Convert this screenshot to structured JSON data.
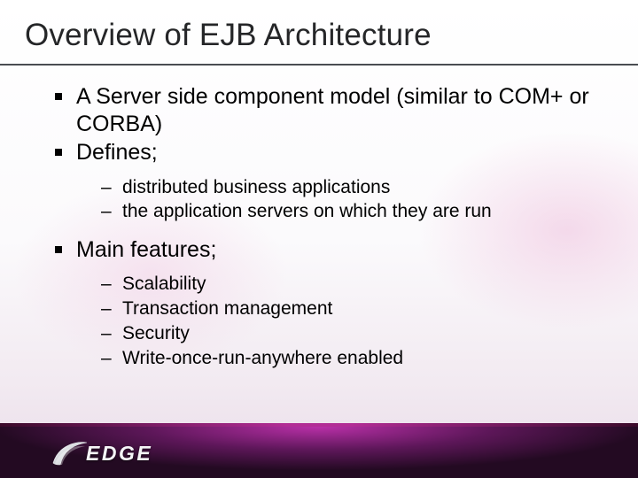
{
  "title": "Overview of EJB Architecture",
  "bullets": {
    "b1": "A Server side component model (similar to COM+ or CORBA)",
    "b2": "Defines;",
    "b2_sub": {
      "s1": "distributed business applications",
      "s2": "the application servers on which they are run"
    },
    "b3": "Main features;",
    "b3_sub": {
      "s1": "Scalability",
      "s2": "Transaction management",
      "s3": "Security",
      "s4": "Write-once-run-anywhere enabled"
    }
  },
  "footer": {
    "logo_text": "EDGE"
  }
}
